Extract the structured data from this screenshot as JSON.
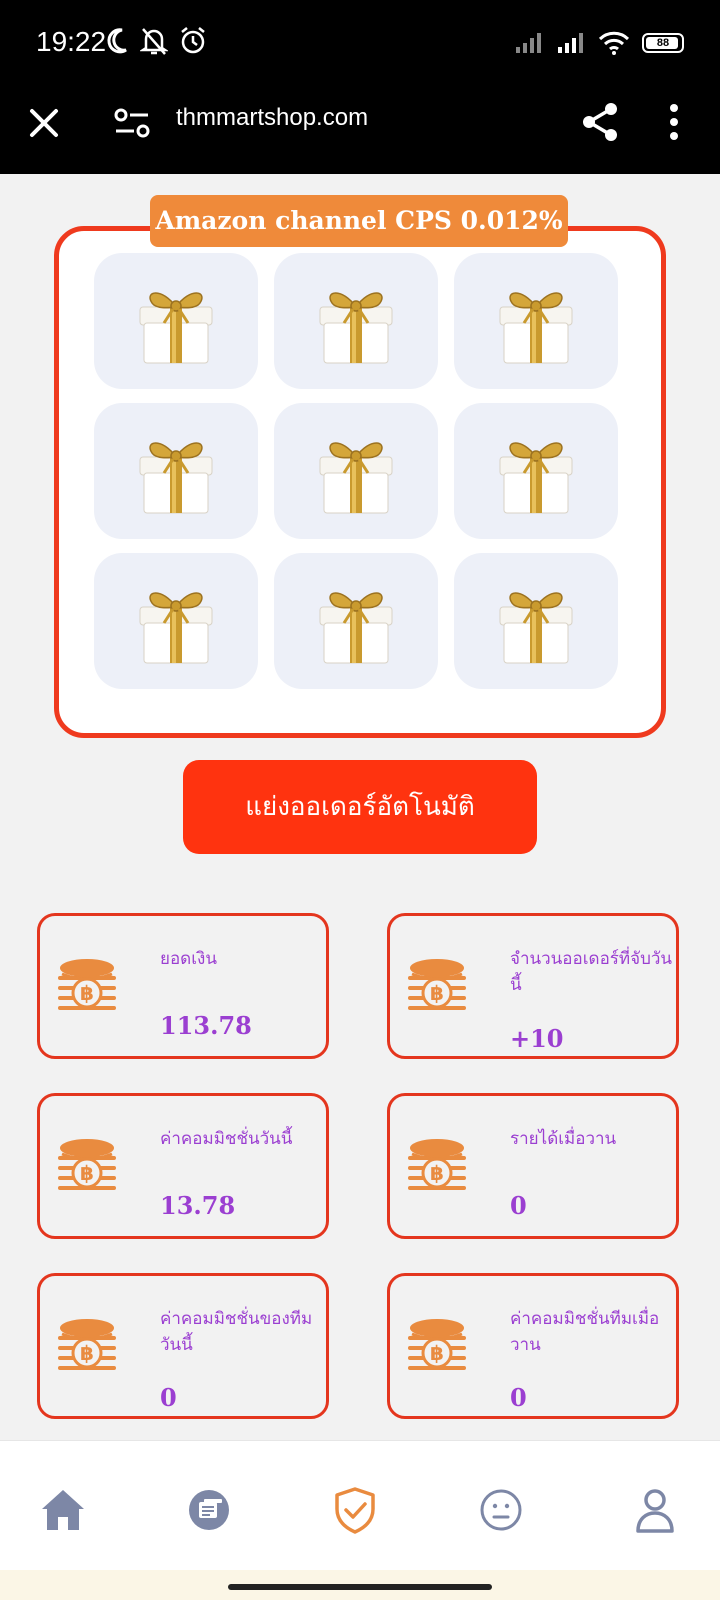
{
  "status_bar": {
    "time": "19:22",
    "battery": "88"
  },
  "browser": {
    "url": "thmmartshop.com"
  },
  "gift_panel": {
    "banner_text": "Amazon channel CPS 0.012%",
    "gift_count": 9
  },
  "auto_button": {
    "label": "แย่งออเดอร์อัตโนมัติ"
  },
  "stats": [
    {
      "label": "ยอดเงิน",
      "value": "113.78"
    },
    {
      "label": "จำนวนออเดอร์ที่จับวันนี้",
      "value": "+10"
    },
    {
      "label": "ค่าคอมมิชชั่นวันนี้",
      "value": "13.78"
    },
    {
      "label": "รายได้เมื่อวาน",
      "value": "0"
    },
    {
      "label": "ค่าคอมมิชชั่นของทีมวันนี้",
      "value": "0"
    },
    {
      "label": "ค่าคอมมิชชั่นทีมเมื่อวาน",
      "value": "0"
    }
  ],
  "nav": {
    "items": [
      "home-icon",
      "order-icon",
      "shield-check-icon",
      "chat-face-icon",
      "profile-icon"
    ],
    "active_color": "#e98b3f",
    "inactive_color": "#7d87a6"
  },
  "colors": {
    "accent_orange": "#ef8a3a",
    "button_red": "#ff330f",
    "card_border": "#e4361e",
    "value_purple": "#9b3fd1",
    "coin_orange": "#e98b3f"
  }
}
